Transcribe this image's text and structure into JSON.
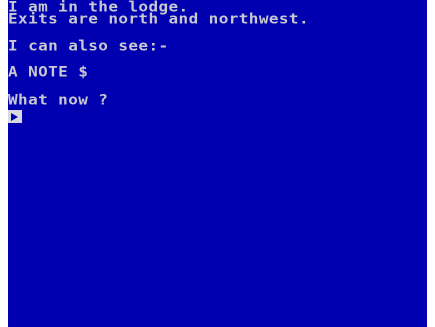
{
  "screen": {
    "lines": [
      "I am in the lodge.",
      "Exits are north and northwest.",
      "I can also see:-",
      "A NOTE",
      "What now ?"
    ],
    "note_symbol": "$",
    "prompt_cursor": "input-cursor"
  },
  "colors": {
    "background": "#0000b0",
    "text": "#c8c8d0",
    "border": "#ffffff"
  }
}
